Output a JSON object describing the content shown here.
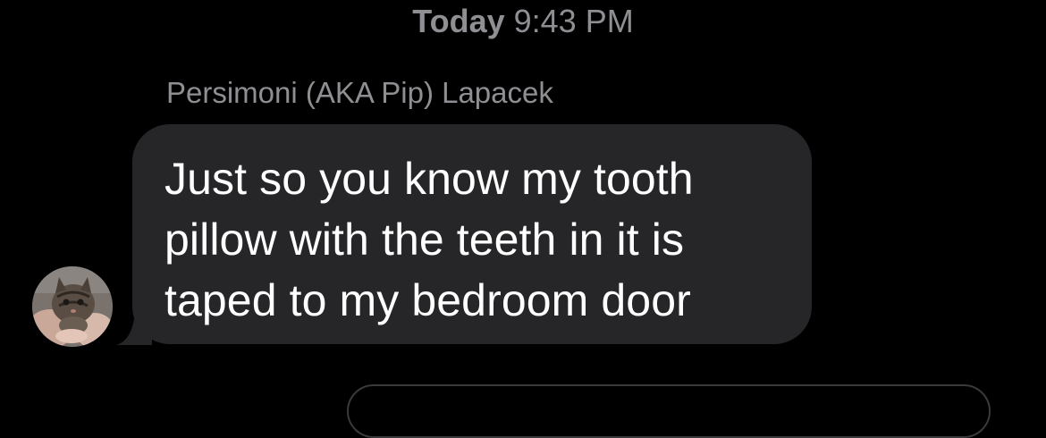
{
  "thread": {
    "timestamp": {
      "day": "Today",
      "time": "9:43 PM"
    },
    "messages": [
      {
        "sender": "Persimoni (AKA Pip) Lapacek",
        "text": "Just so you know my tooth\npillow with the teeth in it is\ntaped to my bedroom door",
        "avatar_icon": "kitten-photo-avatar",
        "direction": "incoming"
      }
    ]
  },
  "colors": {
    "background": "#000000",
    "incoming_bubble": "#262628",
    "secondary_text": "#8e8e93",
    "message_text": "#ffffff"
  }
}
